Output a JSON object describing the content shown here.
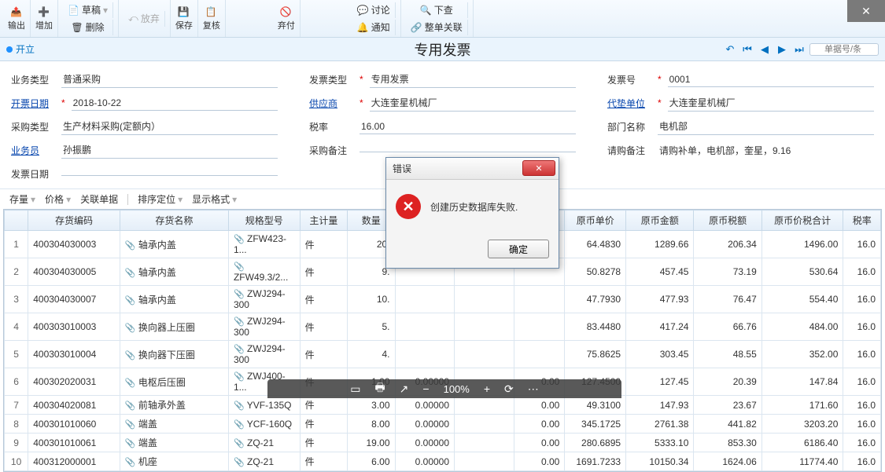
{
  "toolbar": {
    "export": "输出",
    "add": "增加",
    "draft": "草稿",
    "delete": "删除",
    "abandon": "放弃",
    "save": "保存",
    "audit": "复核",
    "discard": "弃付",
    "discuss": "讨论",
    "notify": "通知",
    "check": "下查",
    "related": "整单关联"
  },
  "close": "✕",
  "title_bar": {
    "state": "开立",
    "title": "专用发票"
  },
  "nav": {
    "search_placeholder": "单据号/条"
  },
  "form": {
    "biz_type_lbl": "业务类型",
    "biz_type": "普通采购",
    "inv_date_lbl": "开票日期",
    "inv_date": "2018-10-22",
    "pur_type_lbl": "采购类型",
    "pur_type": "生产材料采购(定额内）",
    "sales_lbl": "业务员",
    "sales": "孙振鹏",
    "inv_date2_lbl": "发票日期",
    "inv_date2": "",
    "inv_type_lbl": "发票类型",
    "inv_type": "专用发票",
    "supplier_lbl": "供应商",
    "supplier": "大连奎星机械厂",
    "tax_rate_lbl": "税率",
    "tax_rate": "16.00",
    "pur_memo_lbl": "采购备注",
    "pur_memo": "",
    "inv_no_lbl": "发票号",
    "inv_no": "0001",
    "adv_unit_lbl": "代垫单位",
    "adv_unit": "大连奎星机械厂",
    "dept_lbl": "部门名称",
    "dept": "电机部",
    "req_memo_lbl": "请购备注",
    "req_memo": "请购补单，电机部，奎星，9.16"
  },
  "grid_toolbar": {
    "stock": "存量",
    "price": "价格",
    "related": "关联单据",
    "sort": "排序定位",
    "display": "显示格式"
  },
  "columns": {
    "c0": "",
    "c1": "存货编码",
    "c2": "存货名称",
    "c3": "规格型号",
    "c4": "主计量",
    "c5": "数量",
    "c6": "",
    "c7": "",
    "c8": "",
    "c9": "原币单价",
    "c10": "原币金额",
    "c11": "原币税额",
    "c12": "原币价税合计",
    "c13": "税率"
  },
  "rows": [
    {
      "n": "1",
      "code": "400304030003",
      "name": "轴承内盖",
      "spec": "ZFW423-1...",
      "unit": "件",
      "qty": "20.",
      "p6": "",
      "p7": "",
      "p8": "",
      "price": "64.4830",
      "amt": "1289.66",
      "tax": "206.34",
      "total": "1496.00",
      "rate": "16.0"
    },
    {
      "n": "2",
      "code": "400304030005",
      "name": "轴承内盖",
      "spec": "ZFW49.3/2...",
      "unit": "件",
      "qty": "9.",
      "p6": "",
      "p7": "",
      "p8": "",
      "price": "50.8278",
      "amt": "457.45",
      "tax": "73.19",
      "total": "530.64",
      "rate": "16.0"
    },
    {
      "n": "3",
      "code": "400304030007",
      "name": "轴承内盖",
      "spec": "ZWJ294-300",
      "unit": "件",
      "qty": "10.",
      "p6": "",
      "p7": "",
      "p8": "",
      "price": "47.7930",
      "amt": "477.93",
      "tax": "76.47",
      "total": "554.40",
      "rate": "16.0"
    },
    {
      "n": "4",
      "code": "400303010003",
      "name": "换向器上压圈",
      "spec": "ZWJ294-300",
      "unit": "件",
      "qty": "5.",
      "p6": "",
      "p7": "",
      "p8": "",
      "price": "83.4480",
      "amt": "417.24",
      "tax": "66.76",
      "total": "484.00",
      "rate": "16.0"
    },
    {
      "n": "5",
      "code": "400303010004",
      "name": "换向器下压圈",
      "spec": "ZWJ294-300",
      "unit": "件",
      "qty": "4.",
      "p6": "",
      "p7": "",
      "p8": "",
      "price": "75.8625",
      "amt": "303.45",
      "tax": "48.55",
      "total": "352.00",
      "rate": "16.0"
    },
    {
      "n": "6",
      "code": "400302020031",
      "name": "电枢后压圈",
      "spec": "ZWJ400-1...",
      "unit": "件",
      "qty": "1.00",
      "p6": "0.00000",
      "p7": "",
      "p8": "0.00",
      "price": "127.4500",
      "amt": "127.45",
      "tax": "20.39",
      "total": "147.84",
      "rate": "16.0"
    },
    {
      "n": "7",
      "code": "400304020081",
      "name": "前轴承外盖",
      "spec": "YVF-135Q",
      "unit": "件",
      "qty": "3.00",
      "p6": "0.00000",
      "p7": "",
      "p8": "0.00",
      "price": "49.3100",
      "amt": "147.93",
      "tax": "23.67",
      "total": "171.60",
      "rate": "16.0"
    },
    {
      "n": "8",
      "code": "400301010060",
      "name": "端盖",
      "spec": "YCF-160Q",
      "unit": "件",
      "qty": "8.00",
      "p6": "0.00000",
      "p7": "",
      "p8": "0.00",
      "price": "345.1725",
      "amt": "2761.38",
      "tax": "441.82",
      "total": "3203.20",
      "rate": "16.0"
    },
    {
      "n": "9",
      "code": "400301010061",
      "name": "端盖",
      "spec": "ZQ-21",
      "unit": "件",
      "qty": "19.00",
      "p6": "0.00000",
      "p7": "",
      "p8": "0.00",
      "price": "280.6895",
      "amt": "5333.10",
      "tax": "853.30",
      "total": "6186.40",
      "rate": "16.0"
    },
    {
      "n": "10",
      "code": "400312000001",
      "name": "机座",
      "spec": "ZQ-21",
      "unit": "件",
      "qty": "6.00",
      "p6": "0.00000",
      "p7": "",
      "p8": "0.00",
      "price": "1691.7233",
      "amt": "10150.34",
      "tax": "1624.06",
      "total": "11774.40",
      "rate": "16.0"
    }
  ],
  "dialog": {
    "title": "错误",
    "message": "创建历史数据库失败.",
    "ok": "确定"
  },
  "zoom": {
    "pct": "100%"
  }
}
